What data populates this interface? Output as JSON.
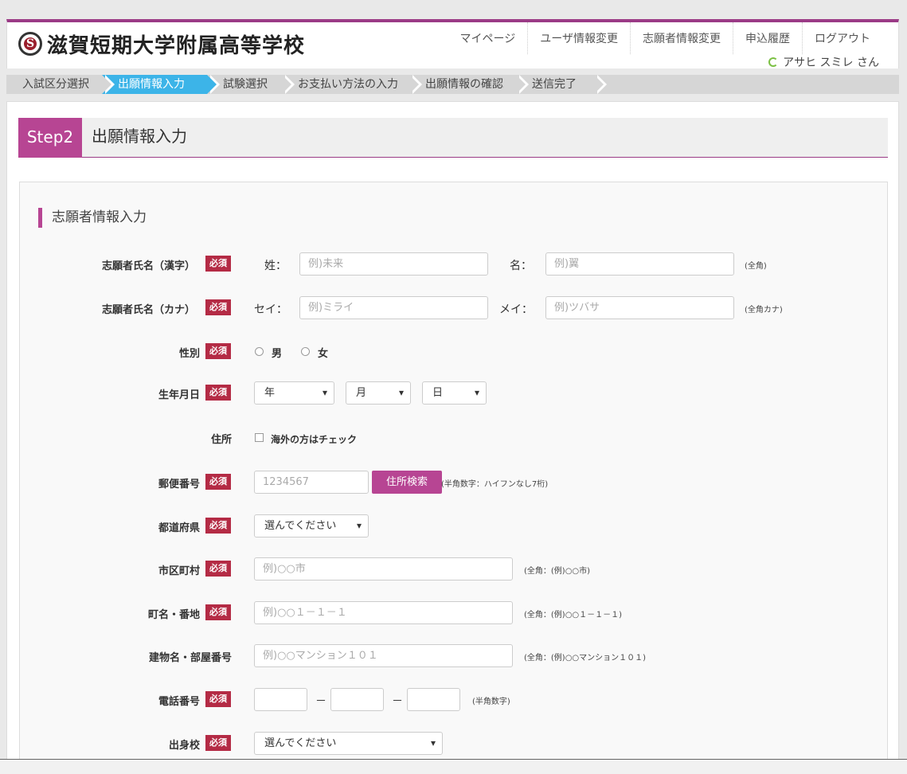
{
  "header": {
    "logo_mark": "S",
    "logo_text": "滋賀短期大学附属高等学校",
    "nav": [
      "マイページ",
      "ユーザ情報変更",
      "志願者情報変更",
      "申込履歴",
      "ログアウト"
    ],
    "user_name": "アサヒ スミレ さん",
    "accent_color": "#9b3b86"
  },
  "progress": {
    "steps": [
      "入試区分選択",
      "出願情報入力",
      "試験選択",
      "お支払い方法の入力",
      "出願情報の確認",
      "送信完了"
    ],
    "active_index": 1,
    "active_color": "#3cb4e8"
  },
  "step": {
    "badge": "Step2",
    "title": "出願情報入力"
  },
  "section": {
    "title": "志願者情報入力"
  },
  "required_label": "必須",
  "form": {
    "name_kanji": {
      "label": "志願者氏名（漢字）",
      "sei_label": "姓：",
      "sei_placeholder": "例)未来",
      "mei_label": "名：",
      "mei_placeholder": "例)翼",
      "note": "(全角)"
    },
    "name_kana": {
      "label": "志願者氏名（カナ）",
      "sei_label": "セイ：",
      "sei_placeholder": "例)ミライ",
      "mei_label": "メイ：",
      "mei_placeholder": "例)ツバサ",
      "note": "(全角カナ)"
    },
    "gender": {
      "label": "性別",
      "male": "男",
      "female": "女"
    },
    "birthdate": {
      "label": "生年月日",
      "year": "年",
      "month": "月",
      "day": "日"
    },
    "address": {
      "label": "住所",
      "overseas": "海外の方はチェック"
    },
    "postal": {
      "label": "郵便番号",
      "placeholder": "1234567",
      "button": "住所検索",
      "note": "(半角数字：ハイフンなし7桁)"
    },
    "prefecture": {
      "label": "都道府県",
      "value": "選んでください"
    },
    "city": {
      "label": "市区町村",
      "placeholder": "例)○○市",
      "note": "(全角：(例)○○市)"
    },
    "town": {
      "label": "町名・番地",
      "placeholder": "例)○○１－１－１",
      "note": "(全角：(例)○○１－１－１)"
    },
    "building": {
      "label": "建物名・部屋番号",
      "placeholder": "例)○○マンション１０１",
      "note": "(全角：(例)○○マンション１０１)"
    },
    "phone": {
      "label": "電話番号",
      "separator": "－",
      "note": "(半角数字)"
    },
    "school": {
      "label": "出身校",
      "value": "選んでください"
    }
  }
}
